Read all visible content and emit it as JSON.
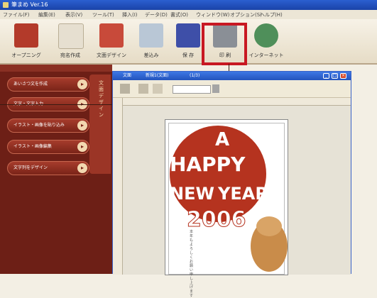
{
  "app": {
    "title": "筆まめ Ver.16"
  },
  "menu": [
    "ファイル(F)",
    "編集(E)",
    "表示(V)",
    "ツール(T)",
    "挿入(I)",
    "データ(D)",
    "書式(O)",
    "ウィンドウ(W)",
    "オプション(S)",
    "ヘルプ(H)"
  ],
  "toolbar": [
    {
      "label": "オープニング",
      "color": "#b33a2a"
    },
    {
      "label": "宛名作成",
      "color": "#d8d0c0"
    },
    {
      "label": "文面デザイン",
      "color": "#c84a3a"
    },
    {
      "label": "差込み",
      "color": "#b9c7d6"
    },
    {
      "label": "保 存",
      "color": "#3e4fa8"
    },
    {
      "label": "印 刷",
      "color": "#8a8f96"
    },
    {
      "label": "インターネット",
      "color": "#4f8f5a"
    }
  ],
  "toolbar_right": [
    "",
    "",
    ""
  ],
  "sidebar": {
    "tab_text": "文面デザイン",
    "buttons": [
      "あいさつ文を作成",
      "文字・文字入力",
      "イラスト・画像を貼り込み",
      "イラスト・画像編集",
      "文字列をデザイン"
    ]
  },
  "window": {
    "title_left": "文面",
    "title_mid": "新規1(文面)",
    "title_right": "(1/3)"
  },
  "card": {
    "letters": [
      "A",
      "HAPPY",
      "NEW",
      "YEAR",
      "2006"
    ],
    "red_color": "#b5331f",
    "side_text": "本年もよろしくお願い申し上げます"
  },
  "highlight": {
    "target": "印刷",
    "color": "#c81822"
  }
}
